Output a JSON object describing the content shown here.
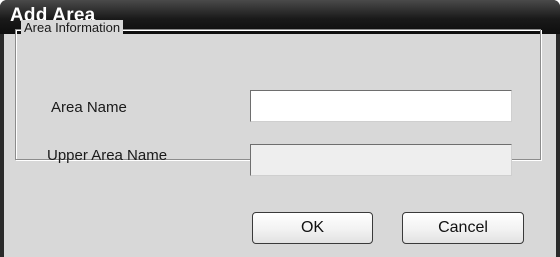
{
  "dialog": {
    "title": "Add Area"
  },
  "group": {
    "legend": "Area Information"
  },
  "fields": {
    "area_name": {
      "label": "Area Name",
      "value": ""
    },
    "upper_area_name": {
      "label": "Upper Area Name",
      "value": ""
    }
  },
  "buttons": {
    "ok_label": "OK",
    "cancel_label": "Cancel"
  },
  "colors": {
    "titlebar": "#1a1a1a",
    "body": "#d8d8d8",
    "disabled_field": "#eeeeee"
  }
}
